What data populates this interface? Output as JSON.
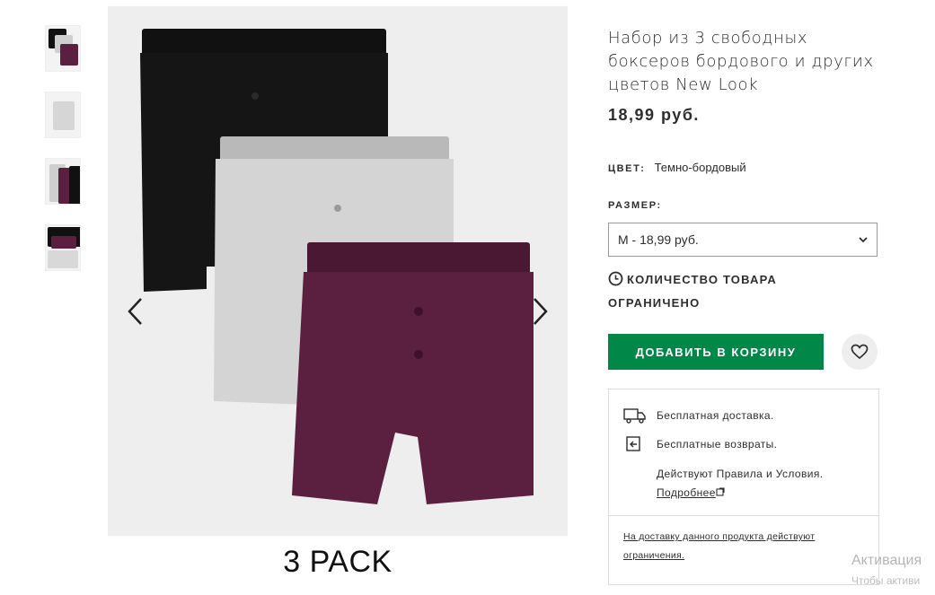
{
  "product": {
    "title": "Набор из 3 свободных боксеров бордового и других цветов New Look",
    "price": "18,99 руб."
  },
  "gallery": {
    "caption": "3 PACK",
    "thumbnails": [
      "thumbnail-1",
      "thumbnail-2",
      "thumbnail-3",
      "thumbnail-4"
    ],
    "icons": {
      "prev": "chevron-left-icon",
      "next": "chevron-right-icon"
    }
  },
  "colour": {
    "label": "ЦВЕТ:",
    "value": "Темно-бордовый"
  },
  "size": {
    "label": "РАЗМЕР:",
    "selected": "M - 18,99 руб."
  },
  "stock": {
    "text": "КОЛИЧЕСТВО ТОВАРА ОГРАНИЧЕНО",
    "icon": "clock-icon"
  },
  "actions": {
    "add_to_bag": "ДОБАВИТЬ В КОРЗИНУ",
    "save_icon": "heart-icon"
  },
  "delivery": {
    "free_delivery": "Бесплатная доставка.",
    "free_returns": "Бесплатные возвраты.",
    "terms_text": "Действуют Правила и Условия.",
    "terms_link": "Подробнее",
    "restriction_note": "На доставку данного продукта действуют ограничения.",
    "icons": {
      "delivery": "truck-icon",
      "returns": "return-icon",
      "external": "external-link-icon"
    }
  },
  "system": {
    "watermark_line1": "Активация",
    "watermark_line2": "Чтобы активи"
  },
  "colors": {
    "accent_green": "#018849",
    "burgundy": "#5b1f3f",
    "text": "#2d2d2d"
  }
}
